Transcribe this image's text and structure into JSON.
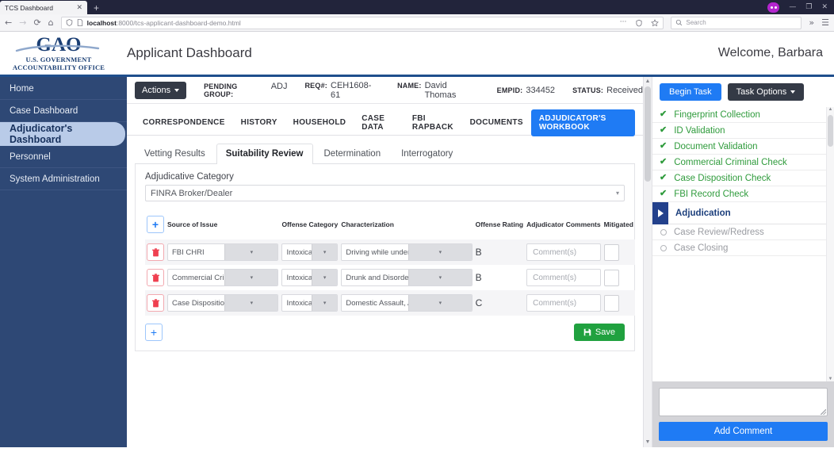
{
  "browser": {
    "tab_title": "TCS Dashboard",
    "close_glyph": "✕",
    "newtab_glyph": "+",
    "url_host": "localhost",
    "url_rest": ":8000/tcs-applicant-dashboard-demo.html",
    "search_placeholder": "Search",
    "back_glyph": "←",
    "forward_glyph": "→",
    "reload_glyph": "⟳",
    "home_glyph": "⌂",
    "more_glyph": "···",
    "overflow_glyph": "»",
    "menu_glyph": "☰",
    "minimize_glyph": "—",
    "maximize_glyph": "❐",
    "close_window_glyph": "✕"
  },
  "header": {
    "logo_main": "GAO",
    "logo_line1": "U.S. GOVERNMENT",
    "logo_line2": "ACCOUNTABILITY OFFICE",
    "app_title": "Applicant Dashboard",
    "welcome": "Welcome, Barbara"
  },
  "sidebar": {
    "items": [
      {
        "label": "Home",
        "active": false
      },
      {
        "label": "Case Dashboard",
        "active": false
      },
      {
        "label": "Adjudicator's Dashboard",
        "active": true
      },
      {
        "label": "Personnel",
        "active": false
      },
      {
        "label": "System Administration",
        "active": false
      }
    ]
  },
  "infobar": {
    "actions_label": "Actions",
    "fields": [
      {
        "label": "Pending Group:",
        "value": "ADJ"
      },
      {
        "label": "Req#:",
        "value": "CEH1608-61"
      },
      {
        "label": "Name:",
        "value": "David Thomas"
      },
      {
        "label": "EmpID:",
        "value": "334452"
      },
      {
        "label": "Status:",
        "value": "Received"
      }
    ]
  },
  "main_tabs": [
    {
      "label": "Correspondence",
      "active": false
    },
    {
      "label": "History",
      "active": false
    },
    {
      "label": "Household",
      "active": false
    },
    {
      "label": "Case Data",
      "active": false
    },
    {
      "label": "FBI Rapback",
      "active": false
    },
    {
      "label": "Documents",
      "active": false
    },
    {
      "label": "Adjudicator's Workbook",
      "active": true
    }
  ],
  "sub_tabs": [
    {
      "label": "Vetting Results",
      "active": false
    },
    {
      "label": "Suitability Review",
      "active": true
    },
    {
      "label": "Determination",
      "active": false
    },
    {
      "label": "Interrogatory",
      "active": false
    }
  ],
  "workbook": {
    "category_label": "Adjudicative Category",
    "category_value": "FINRA Broker/Dealer",
    "add_row_glyph": "+",
    "columns": [
      "Source of Issue",
      "Offense Category",
      "Characterization",
      "Offense Rating",
      "Adjudicator Comments",
      "Mitigated"
    ],
    "comment_placeholder": "Comment(s)",
    "rows": [
      {
        "source": "FBI CHRI",
        "offense_category": "Intoxicants",
        "characterization": "Driving while under the influence",
        "rating": "B",
        "comments": "",
        "mitigated": false
      },
      {
        "source": "Commercial Criminal Results",
        "offense_category": "Intoxicants",
        "characterization": "Drunk and Disorderly",
        "rating": "B",
        "comments": "",
        "mitigated": false
      },
      {
        "source": "Case Disposition Results",
        "offense_category": "Intoxicants",
        "characterization": "Domestic Assault, Alcohol Charges",
        "rating": "C",
        "comments": "",
        "mitigated": false
      }
    ],
    "save_label": "Save"
  },
  "task_panel": {
    "begin_label": "Begin Task",
    "options_label": "Task Options",
    "tasks": [
      {
        "label": "Fingerprint Collection",
        "state": "done"
      },
      {
        "label": "ID Validation",
        "state": "done"
      },
      {
        "label": "Document Validation",
        "state": "done"
      },
      {
        "label": "Commercial Criminal Check",
        "state": "done"
      },
      {
        "label": "Case Disposition Check",
        "state": "done"
      },
      {
        "label": "FBI Record Check",
        "state": "done"
      },
      {
        "label": "Adjudication",
        "state": "current"
      },
      {
        "label": "Case Review/Redress",
        "state": "pending"
      },
      {
        "label": "Case Closing",
        "state": "pending"
      }
    ],
    "comment_value": "",
    "add_comment_label": "Add Comment"
  },
  "colors": {
    "brand_navy": "#1f4e8c",
    "sidebar": "#2e4875",
    "accent_blue": "#1f7bf4",
    "save_green": "#20a13f",
    "done_green": "#2f9b3c",
    "current_navy": "#23418c"
  }
}
